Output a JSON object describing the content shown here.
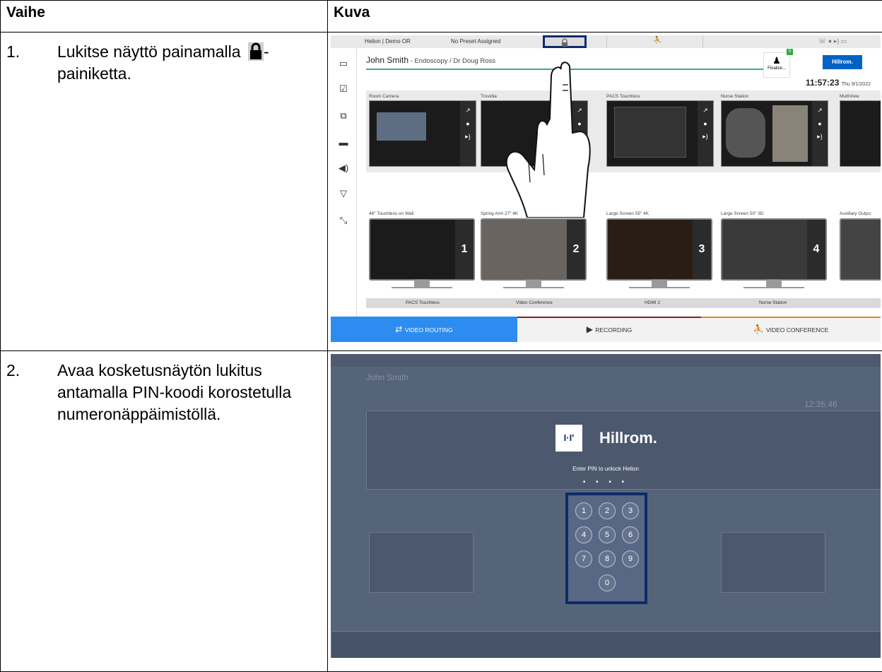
{
  "table": {
    "header_step": "Vaihe",
    "header_image": "Kuva"
  },
  "steps": [
    {
      "number": "1.",
      "text_before": "Lukitse näyttö painamalla ",
      "text_after": "-painiketta."
    },
    {
      "number": "2.",
      "text": "Avaa kosketusnäytön lukitus antamalla PIN-koodi korostetulla numeronäppäimistöllä."
    }
  ],
  "shot1": {
    "system": "Helion | Demo OR",
    "preset": "No Preset Assigned",
    "patient_name": "John Smith",
    "patient_detail": " - Endoscopy / Dr Doug Ross",
    "finalize": "Finalize...",
    "badge": "5",
    "brand": "Hillrom.",
    "time": "11:57:23",
    "date": "Thu 9/1/2022",
    "sources": [
      "Room Camera",
      "Truvidia",
      "PACS Touchless",
      "Nurse Station",
      "MultiView"
    ],
    "displays": [
      "46\" Touchless on Wall",
      "Spring Arm 27\" 4K",
      "Large Screen 55\" 4K",
      "Large Screen 50\" 3D",
      "Auxiliary Outpu"
    ],
    "display_numbers": [
      "1",
      "2",
      "3",
      "4"
    ],
    "assigned": [
      "PACS Touchless",
      "Video Conference",
      "HDMI 2",
      "Nurse Station"
    ],
    "tabs": [
      "VIDEO ROUTING",
      "RECORDING",
      "VIDEO CONFERENCE"
    ],
    "colors": {
      "routing": "#2d8cf0",
      "recording": "#8b1a2b",
      "conference": "#e08a1e",
      "accent": "#3aa99a",
      "highlight": "#0d2b6b"
    }
  },
  "shot2": {
    "brand": "Hillrom.",
    "prompt": "Enter PIN to unlock Helion",
    "pin_dots": "• • • •",
    "keys": [
      "1",
      "2",
      "3",
      "4",
      "5",
      "6",
      "7",
      "8",
      "9",
      "0"
    ],
    "bg_time": "12:35:46"
  }
}
